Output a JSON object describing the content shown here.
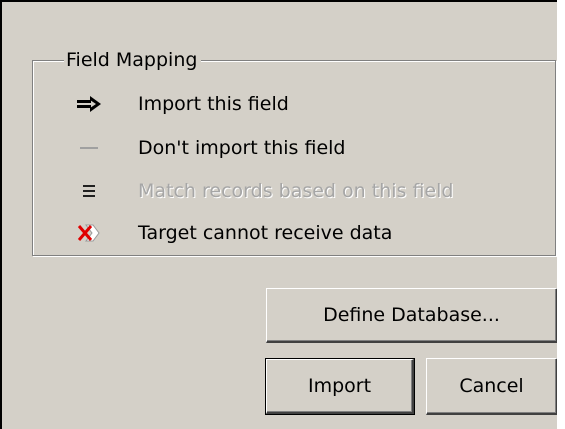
{
  "group": {
    "title": "Field Mapping",
    "items": [
      {
        "icon": "right-arrow-icon",
        "label": "Import this field",
        "enabled": true
      },
      {
        "icon": "dash-icon",
        "label": "Don't import this field",
        "enabled": true
      },
      {
        "icon": "equals-icon",
        "label": "Match records based on this field",
        "enabled": false
      },
      {
        "icon": "red-x-icon",
        "label": "Target cannot receive data",
        "enabled": true
      }
    ]
  },
  "buttons": {
    "define_database": "Define Database...",
    "import": "Import",
    "cancel": "Cancel"
  },
  "colors": {
    "dialog_background": "#d4d0c8",
    "disabled_text": "#a6a6a6",
    "error_red": "#e00000"
  }
}
